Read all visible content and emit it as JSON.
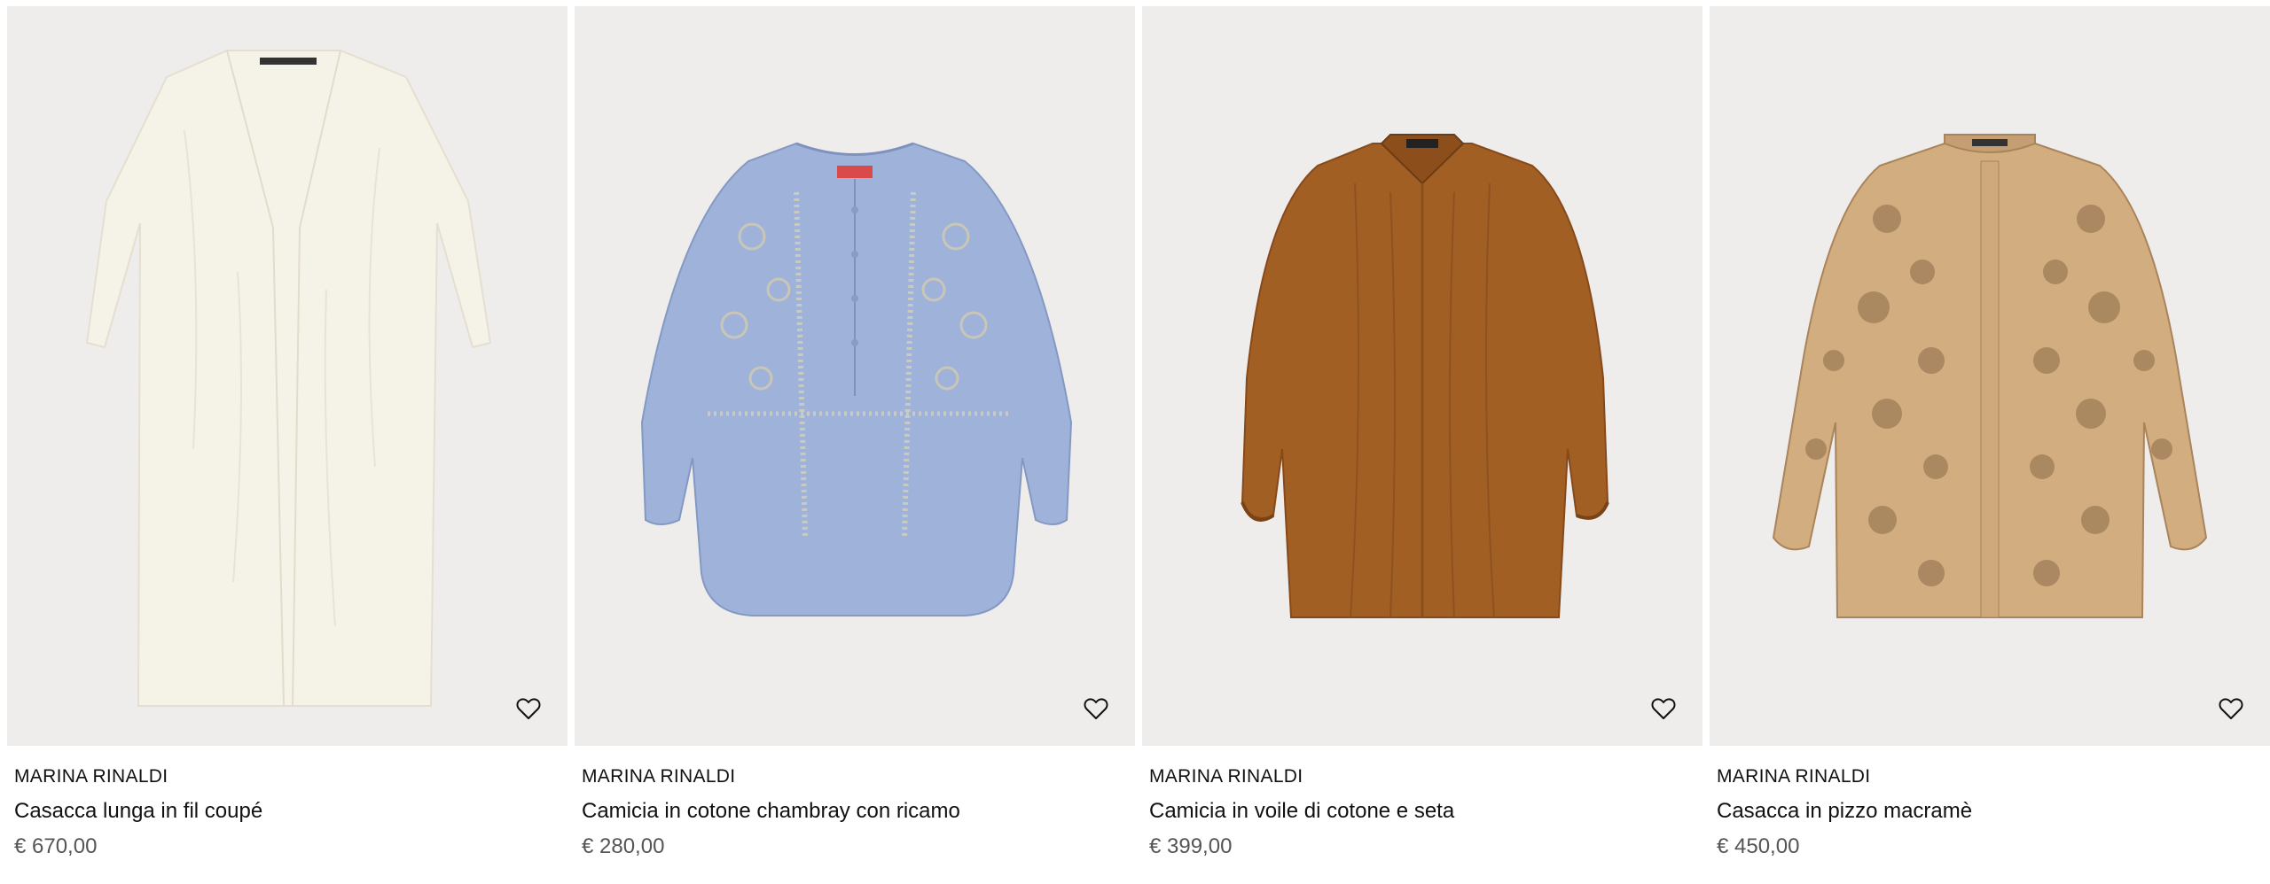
{
  "products": [
    {
      "brand": "MARINA RINALDI",
      "name": "Casacca lunga in fil coupé",
      "price": "€ 670,00",
      "image_color": "#f3efe3",
      "icon": "heart-outline-icon"
    },
    {
      "brand": "MARINA RINALDI",
      "name": "Camicia in cotone chambray con ricamo",
      "price": "€ 280,00",
      "image_color": "#9aaed6",
      "icon": "heart-outline-icon"
    },
    {
      "brand": "MARINA RINALDI",
      "name": "Camicia in voile di cotone e seta",
      "price": "€ 399,00",
      "image_color": "#9a5a22",
      "icon": "heart-outline-icon"
    },
    {
      "brand": "MARINA RINALDI",
      "name": "Casacca in pizzo macramè",
      "price": "€ 450,00",
      "image_color": "#c9a47a",
      "icon": "heart-outline-icon"
    }
  ]
}
